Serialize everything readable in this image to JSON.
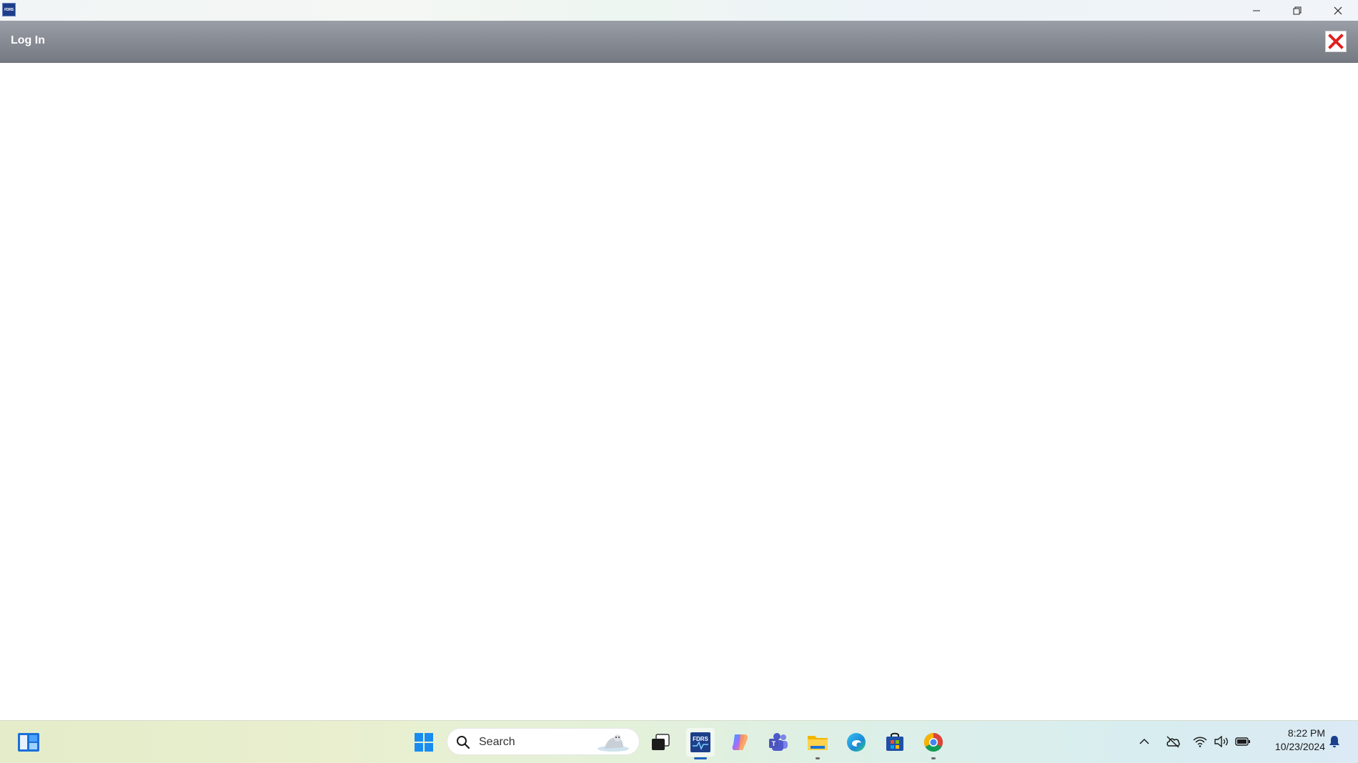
{
  "window": {
    "app_icon_text": "FDRS",
    "controls": [
      "minimize",
      "restore",
      "close"
    ]
  },
  "header": {
    "title": "Log In",
    "close_icon": "red-x-icon"
  },
  "taskbar": {
    "search_placeholder": "Search",
    "apps": [
      {
        "name": "widgets",
        "icon": "widgets-icon"
      },
      {
        "name": "start",
        "icon": "windows-logo-icon"
      },
      {
        "name": "task-view",
        "icon": "task-view-icon"
      },
      {
        "name": "fdrs",
        "icon": "fdrs-app-icon",
        "active": true
      },
      {
        "name": "copilot",
        "icon": "copilot-icon"
      },
      {
        "name": "teams",
        "icon": "teams-icon"
      },
      {
        "name": "file-explorer",
        "icon": "folder-icon",
        "running": true
      },
      {
        "name": "edge",
        "icon": "edge-icon"
      },
      {
        "name": "store",
        "icon": "store-icon"
      },
      {
        "name": "chrome",
        "icon": "chrome-icon",
        "running": true
      }
    ],
    "tray": {
      "icons": [
        "chevron-up-icon",
        "cloud-off-icon",
        "wifi-icon",
        "volume-icon",
        "battery-icon",
        "bell-icon"
      ],
      "time": "8:22 PM",
      "date": "10/23/2024"
    }
  },
  "colors": {
    "header_bg": "#878b93",
    "close_red": "#e02020",
    "accent": "#1f5fbf"
  }
}
